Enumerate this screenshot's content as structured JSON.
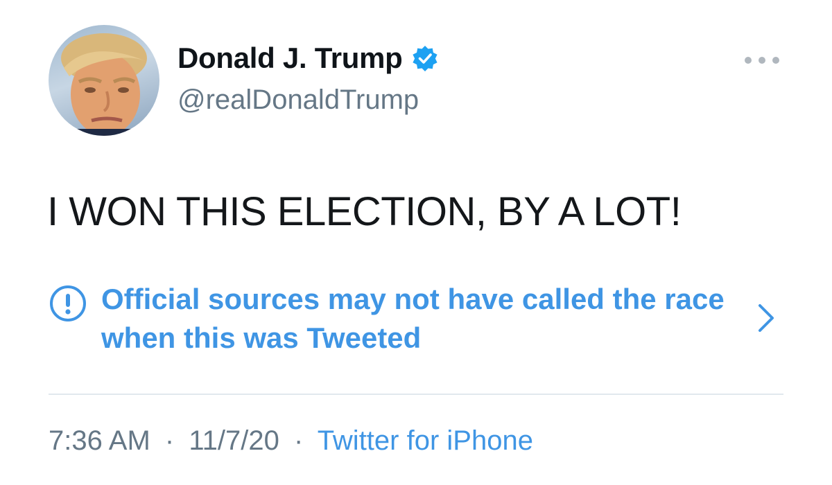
{
  "author": {
    "display_name": "Donald J. Trump",
    "handle": "@realDonaldTrump",
    "avatar_icon": "profile-photo",
    "verified_icon": "verified-badge-icon"
  },
  "tweet": {
    "text": "I WON THIS ELECTION, BY A LOT!"
  },
  "notice": {
    "text": "Official sources may not have called the race when this was Tweeted",
    "icon": "exclamation-circle-icon",
    "chevron_icon": "chevron-right-icon"
  },
  "meta": {
    "time": "7:36 AM",
    "separator": "·",
    "date": "11/7/20",
    "source": "Twitter for iPhone"
  },
  "colors": {
    "accent_blue": "#3f95e4",
    "verified_blue": "#1da1f2",
    "text_primary": "#14171a",
    "text_secondary": "#657786"
  }
}
